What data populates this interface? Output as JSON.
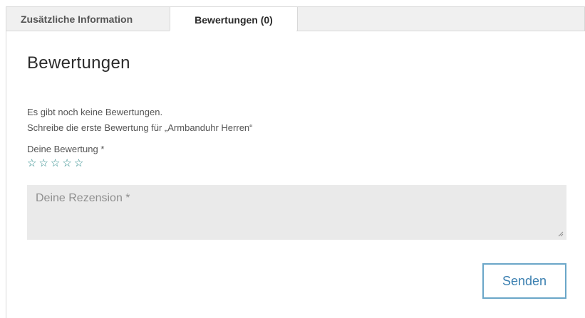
{
  "tabs": [
    {
      "label": "Zusätzliche Information",
      "active": false
    },
    {
      "label": "Bewertungen (0)",
      "active": true
    }
  ],
  "reviews": {
    "title": "Bewertungen",
    "no_reviews_text": "Es gibt noch keine Bewertungen.",
    "first_review_text": "Schreibe die erste Bewertung für „Armbanduhr Herren“",
    "rating_label": "Deine Bewertung *",
    "rating": {
      "value": 0,
      "max": 5
    },
    "star_glyph": "☆",
    "review_placeholder": "Deine Rezension *",
    "review_value": "",
    "submit_label": "Senden"
  },
  "colors": {
    "accent": "#3a7fb0",
    "button_border": "#6aa6c8",
    "star": "#2c8a8a",
    "textarea_bg": "#eaeaea",
    "tab_bg": "#f0f0f0"
  }
}
